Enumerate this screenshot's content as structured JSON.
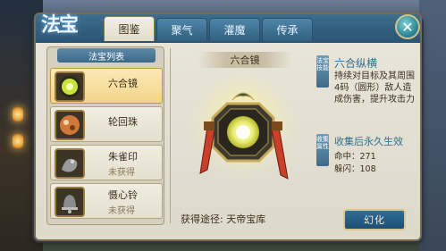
{
  "window": {
    "title_logo": "法宝"
  },
  "tabs": [
    {
      "label": "图鉴"
    },
    {
      "label": "聚气"
    },
    {
      "label": "灌魔"
    },
    {
      "label": "传承"
    }
  ],
  "close": {
    "glyph": "✕"
  },
  "list": {
    "title": "法宝列表",
    "items": [
      {
        "name": "六合镜",
        "status": "",
        "icon": "mirror-icon",
        "color": "#c9e33a"
      },
      {
        "name": "轮回珠",
        "status": "",
        "icon": "orb-icon",
        "color": "#d0783a"
      },
      {
        "name": "朱雀印",
        "status": "未获得",
        "icon": "seal-icon",
        "color": "#9a9a9a"
      },
      {
        "name": "慑心铃",
        "status": "未获得",
        "icon": "bell-icon",
        "color": "#8c8c8c"
      }
    ]
  },
  "detail": {
    "name": "六合镜",
    "source_text": "获得途径: 天帝宝库"
  },
  "info": {
    "tag1": "法宝技能",
    "effect_title": "六合纵横",
    "effect_desc": "持续对目标及其周围4码（圆形）敌人造成伤害，提升攻击力",
    "tag2": "收集属性",
    "perm_title": "收集后永久生效",
    "stat_hit": "命中：271",
    "stat_dodge": "躲闪：108"
  },
  "button": {
    "label": "幻化"
  },
  "colors": {
    "accent_blue": "#2d6f8f",
    "selected_item": "#f2d58a",
    "treasure_glow": "#f6f0b0"
  }
}
